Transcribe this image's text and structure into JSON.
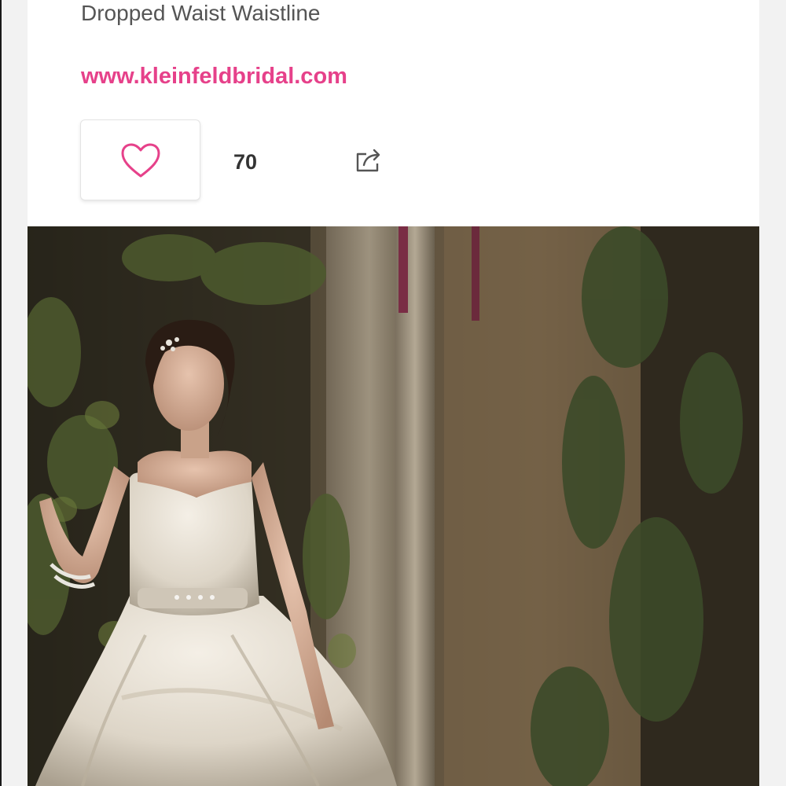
{
  "listing": {
    "waistline_text": "Dropped Waist Waistline",
    "website_link": "www.kleinfeldbridal.com"
  },
  "actions": {
    "like_count": "70"
  },
  "colors": {
    "accent_pink": "#e6418a",
    "text_gray": "#555555",
    "count_dark": "#333333"
  },
  "icons": {
    "like": "heart-icon",
    "share": "share-icon"
  }
}
